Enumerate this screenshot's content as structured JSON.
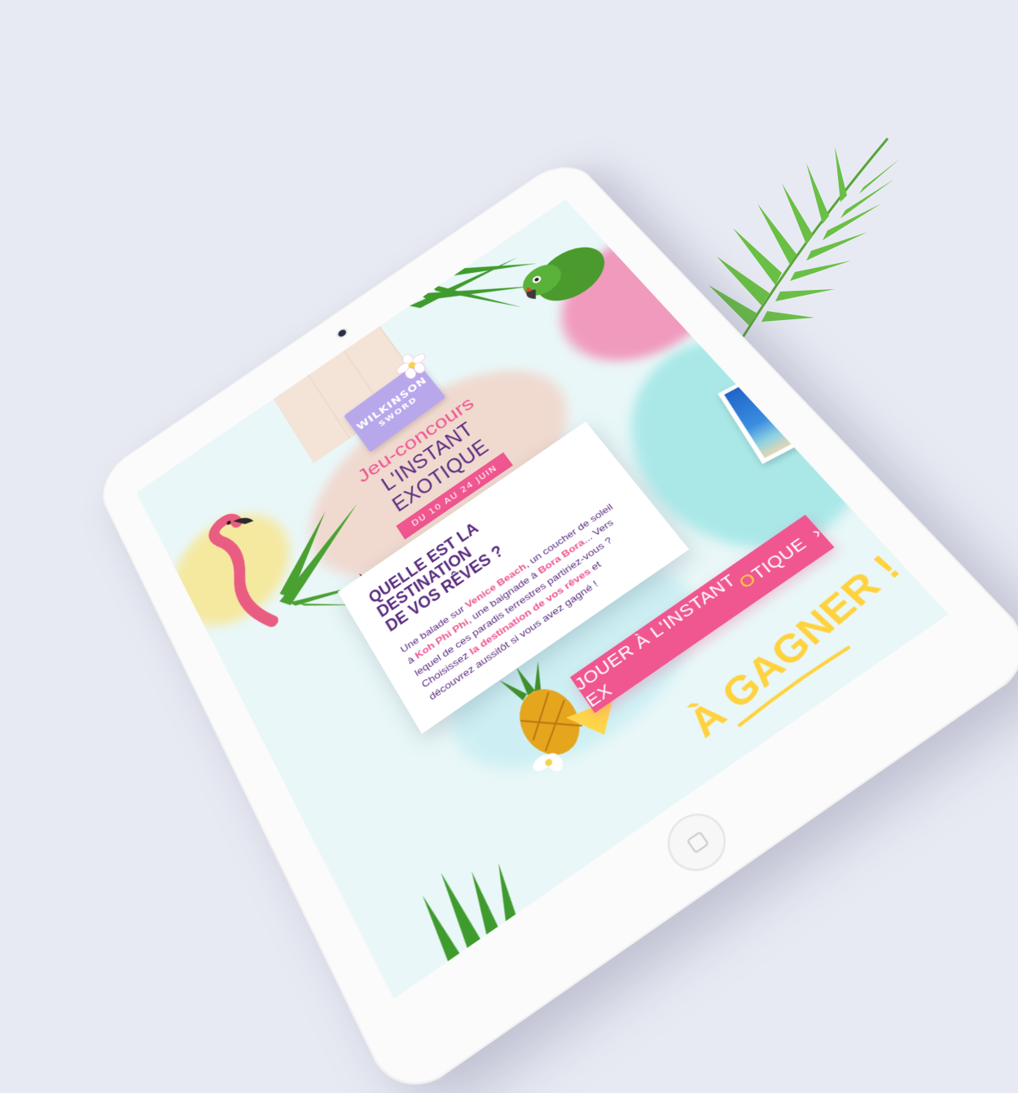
{
  "brand": {
    "logo_line1": "WILKINSON",
    "logo_line2": "SWORD"
  },
  "hero": {
    "title_line1": "Jeu-concours",
    "title_line2": "L'INSTANT EXOTIQUE",
    "date_badge": "DU 10 AU 24 JUIN"
  },
  "card": {
    "heading_line1": "QUELLE EST LA DESTINATION",
    "heading_line2": "DE VOS RÊVES ?",
    "body": {
      "t1": "Une balade sur ",
      "h1": "Venice Beach",
      "t2": ", un coucher de soleil à ",
      "h2": "Koh Phi Phi",
      "t3": ", une baignade à ",
      "h3": "Bora Bora",
      "t4": "... Vers lequel de ces paradis terrestres partiriez-vous ? Choisissez ",
      "h4": "la destination de vos rêves",
      "t5": " et découvrez aussitôt si vous avez gagné !"
    }
  },
  "cta": {
    "label_before": "JOUER À L'INSTANT EX",
    "label_accent": "O",
    "label_after": "TIQUE",
    "chevron": "›"
  },
  "prize": {
    "label": "À GAGNER !"
  },
  "colors": {
    "pink": "#f0568f",
    "purple": "#5a2d81",
    "lavender": "#b9a7ec",
    "yellow": "#ffd23e"
  },
  "icons": [
    "flamingo-icon",
    "parrot-icon",
    "pineapple-icon",
    "palm-leaf-icon",
    "frangipani-flower-icon",
    "hibiscus-flower-icon"
  ]
}
